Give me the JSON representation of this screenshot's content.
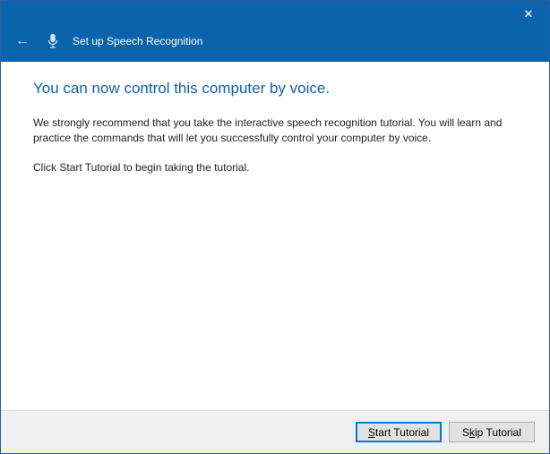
{
  "titlebar": {
    "close_label": "✕"
  },
  "header": {
    "title": "Set up Speech Recognition"
  },
  "content": {
    "heading": "You can now control this computer by voice.",
    "paragraph1": "We strongly recommend that you take the interactive speech recognition tutorial. You will learn and practice the commands that will let you successfully control your computer by voice.",
    "paragraph2": "Click Start Tutorial to begin taking the tutorial."
  },
  "footer": {
    "start_label": "Start Tutorial",
    "skip_prefix": "S",
    "skip_underline": "k",
    "skip_suffix": "ip Tutorial"
  },
  "icons": {
    "back": "←",
    "mic": "microphone-icon"
  },
  "colors": {
    "accent": "#0a63ab",
    "focus": "#0078d7"
  }
}
